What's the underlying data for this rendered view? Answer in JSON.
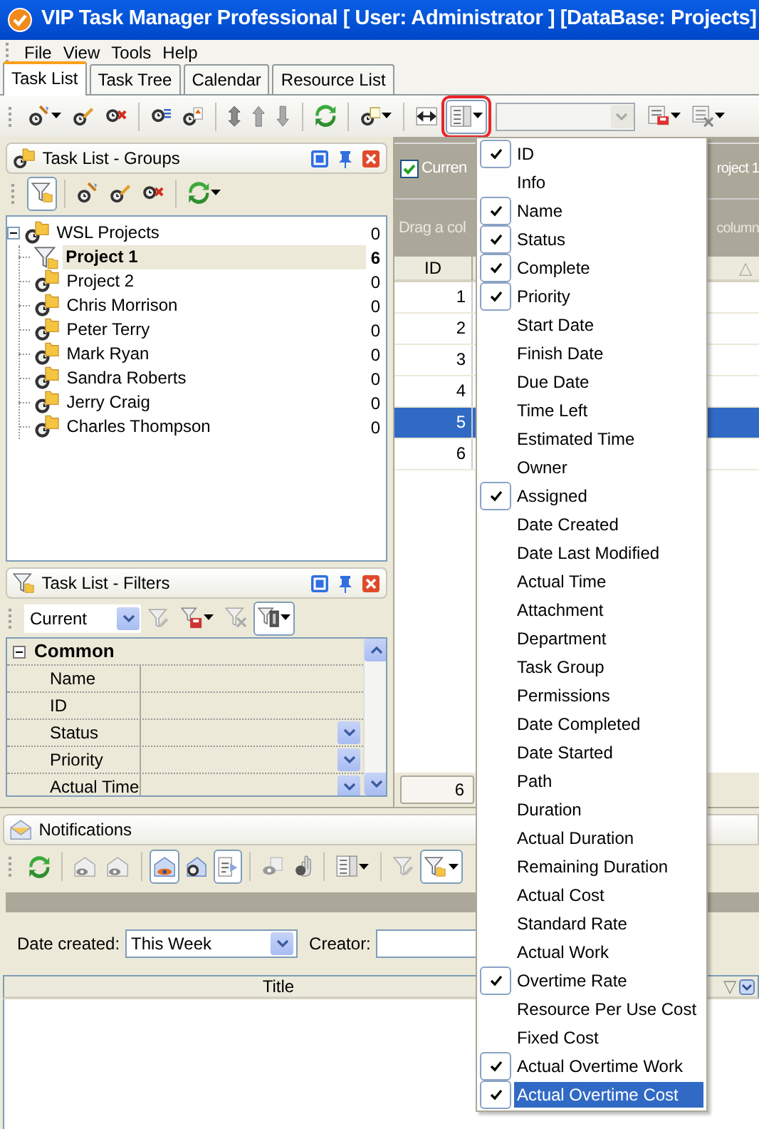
{
  "window": {
    "title": "VIP Task Manager Professional [ User: Administrator ] [DataBase: Projects]"
  },
  "menu_bar": [
    "File",
    "View",
    "Tools",
    "Help"
  ],
  "tabs": [
    {
      "label": "Task List",
      "selected": true
    },
    {
      "label": "Task Tree",
      "selected": false
    },
    {
      "label": "Calendar",
      "selected": false
    },
    {
      "label": "Resource List",
      "selected": false
    }
  ],
  "toolbar": [
    {
      "pressed": false
    },
    {
      "pressed": false
    },
    {
      "pressed": false
    },
    {
      "pressed": false
    },
    {
      "pressed": false
    },
    {
      "pressed": false
    },
    {
      "pressed": false
    },
    {
      "pressed": false
    },
    {
      "pressed": false
    },
    {
      "pressed": false
    },
    {
      "pressed": false
    },
    {
      "pressed": true
    },
    {
      "pressed": false
    },
    {
      "pressed": false
    }
  ],
  "groups_panel": {
    "title": "Task List - Groups",
    "toolbar": [
      {
        "pressed": true
      },
      {
        "pressed": false
      },
      {
        "pressed": false
      },
      {
        "pressed": false
      },
      {
        "pressed": false
      }
    ],
    "tree": [
      {
        "label": "WSL Projects",
        "count": "0",
        "kind": "group",
        "selected": false,
        "expanded": true,
        "children": [
          {
            "label": "Project 1",
            "count": "6",
            "kind": "filter",
            "selected": true
          },
          {
            "label": "Project 2",
            "count": "0",
            "kind": "group",
            "selected": false
          },
          {
            "label": "Chris Morrison",
            "count": "0",
            "kind": "group",
            "selected": false
          },
          {
            "label": "Peter Terry",
            "count": "0",
            "kind": "group",
            "selected": false
          },
          {
            "label": "Mark Ryan",
            "count": "0",
            "kind": "group",
            "selected": false
          },
          {
            "label": "Sandra Roberts",
            "count": "0",
            "kind": "group",
            "selected": false
          },
          {
            "label": "Jerry Craig",
            "count": "0",
            "kind": "group",
            "selected": false
          },
          {
            "label": "Charles Thompson",
            "count": "0",
            "kind": "group",
            "selected": false
          }
        ]
      }
    ]
  },
  "filters_panel": {
    "title": "Task List - Filters",
    "filter": "Current",
    "toolbar": [
      {
        "pressed": false
      },
      {
        "pressed": false
      },
      {
        "pressed": false
      },
      {
        "pressed": true
      }
    ],
    "category": {
      "label": "Common",
      "expanded": true,
      "rows": [
        {
          "label": "Name",
          "kind": "text"
        },
        {
          "label": "ID",
          "kind": "text"
        },
        {
          "label": "Status",
          "kind": "list"
        },
        {
          "label": "Priority",
          "kind": "list"
        },
        {
          "label": "Actual Time",
          "kind": "list"
        }
      ]
    }
  },
  "task_grid": {
    "current_checked": true,
    "header_left": "Curren",
    "header_right": "roject 1",
    "group_hint_left": "Drag a col",
    "group_hint_right": "column",
    "columns": [
      "ID"
    ],
    "sort_indicator": "△",
    "rows": [
      {
        "id": "1",
        "selected": false
      },
      {
        "id": "2",
        "selected": false
      },
      {
        "id": "3",
        "selected": false
      },
      {
        "id": "4",
        "selected": false
      },
      {
        "id": "5",
        "selected": true
      },
      {
        "id": "6",
        "selected": false
      }
    ],
    "footer": "6"
  },
  "column_menu": [
    {
      "label": "ID",
      "checked": true,
      "selected": false
    },
    {
      "label": "Info",
      "checked": false,
      "selected": false
    },
    {
      "label": "Name",
      "checked": true,
      "selected": false
    },
    {
      "label": "Status",
      "checked": true,
      "selected": false
    },
    {
      "label": "Complete",
      "checked": true,
      "selected": false
    },
    {
      "label": "Priority",
      "checked": true,
      "selected": false
    },
    {
      "label": "Start Date",
      "checked": false,
      "selected": false
    },
    {
      "label": "Finish Date",
      "checked": false,
      "selected": false
    },
    {
      "label": "Due Date",
      "checked": false,
      "selected": false
    },
    {
      "label": "Time Left",
      "checked": false,
      "selected": false
    },
    {
      "label": "Estimated Time",
      "checked": false,
      "selected": false
    },
    {
      "label": "Owner",
      "checked": false,
      "selected": false
    },
    {
      "label": "Assigned",
      "checked": true,
      "selected": false
    },
    {
      "label": "Date Created",
      "checked": false,
      "selected": false
    },
    {
      "label": "Date Last Modified",
      "checked": false,
      "selected": false
    },
    {
      "label": "Actual Time",
      "checked": false,
      "selected": false
    },
    {
      "label": "Attachment",
      "checked": false,
      "selected": false
    },
    {
      "label": "Department",
      "checked": false,
      "selected": false
    },
    {
      "label": "Task Group",
      "checked": false,
      "selected": false
    },
    {
      "label": "Permissions",
      "checked": false,
      "selected": false
    },
    {
      "label": "Date Completed",
      "checked": false,
      "selected": false
    },
    {
      "label": "Date Started",
      "checked": false,
      "selected": false
    },
    {
      "label": "Path",
      "checked": false,
      "selected": false
    },
    {
      "label": "Duration",
      "checked": false,
      "selected": false
    },
    {
      "label": "Actual Duration",
      "checked": false,
      "selected": false
    },
    {
      "label": "Remaining Duration",
      "checked": false,
      "selected": false
    },
    {
      "label": "Actual Cost",
      "checked": false,
      "selected": false
    },
    {
      "label": "Standard Rate",
      "checked": false,
      "selected": false
    },
    {
      "label": "Actual Work",
      "checked": false,
      "selected": false
    },
    {
      "label": "Overtime Rate",
      "checked": true,
      "selected": false
    },
    {
      "label": "Resource Per Use Cost",
      "checked": false,
      "selected": false
    },
    {
      "label": "Fixed Cost",
      "checked": false,
      "selected": false
    },
    {
      "label": "Actual Overtime Work",
      "checked": true,
      "selected": false
    },
    {
      "label": "Actual Overtime Cost",
      "checked": true,
      "selected": true
    }
  ],
  "notifications": {
    "title": "Notifications",
    "toolbar": [
      {
        "pressed": false
      },
      {
        "pressed": false
      },
      {
        "pressed": false
      },
      {
        "pressed": true
      },
      {
        "pressed": false
      },
      {
        "pressed": true
      },
      {
        "pressed": false
      },
      {
        "pressed": false
      },
      {
        "pressed": false
      },
      {
        "pressed": false
      },
      {
        "pressed": true
      }
    ],
    "date_label": "Date created:",
    "date_value": "This Week",
    "creator_label": "Creator:",
    "columns": [
      "Title"
    ],
    "sort_indicator": "▽"
  }
}
